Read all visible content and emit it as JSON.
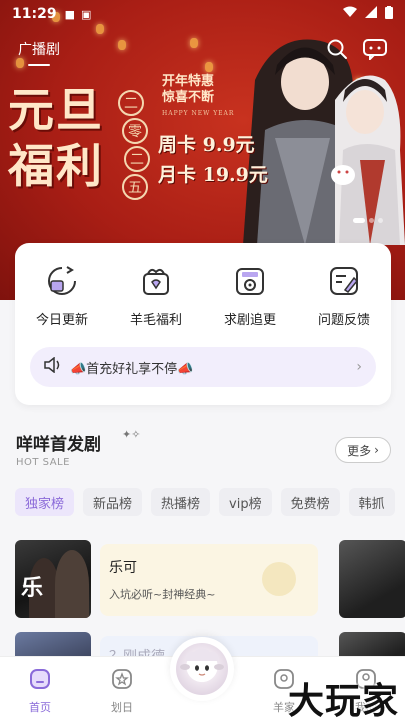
{
  "status_bar": {
    "time": "11:29"
  },
  "header": {
    "active_tab": "广播剧"
  },
  "banner": {
    "headline_line1": "元旦",
    "headline_line2": "福利",
    "date_chars": [
      "二",
      "零",
      "二",
      "五"
    ],
    "promo_line1": "开年特惠",
    "promo_line2": "惊喜不断",
    "promo_en": "HAPPY NEW YEAR",
    "weekly_card": "周卡 9.9元",
    "monthly_card": "月卡 19.9元"
  },
  "quick_actions": [
    {
      "label": "今日更新",
      "icon": "calendar-refresh-icon"
    },
    {
      "label": "羊毛福利",
      "icon": "gift-box-icon"
    },
    {
      "label": "求剧追更",
      "icon": "radio-request-icon"
    },
    {
      "label": "问题反馈",
      "icon": "feedback-pen-icon"
    }
  ],
  "notice": {
    "text": "📣首充好礼享不停📣"
  },
  "section": {
    "title": "咩咩首发剧",
    "subtitle": "HOT SALE",
    "more_label": "更多"
  },
  "chips": [
    "独家榜",
    "新品榜",
    "热播榜",
    "vip榜",
    "免费榜",
    "韩抓"
  ],
  "list": [
    {
      "title": "乐可",
      "desc": "入坑必听~封神经典~",
      "cover_text": "乐"
    },
    {
      "title": "？刚成德",
      "desc": ""
    }
  ],
  "bottom_nav": [
    {
      "label": "首页",
      "icon": "home-icon"
    },
    {
      "label": "划日",
      "icon": "star-badge-icon"
    },
    {
      "label": "羊家",
      "icon": "community-icon"
    },
    {
      "label": "我的",
      "icon": "profile-icon"
    }
  ],
  "watermark": "大玩家",
  "colors": {
    "accent": "#8a6bd9",
    "banner_red": "#a91e15"
  }
}
